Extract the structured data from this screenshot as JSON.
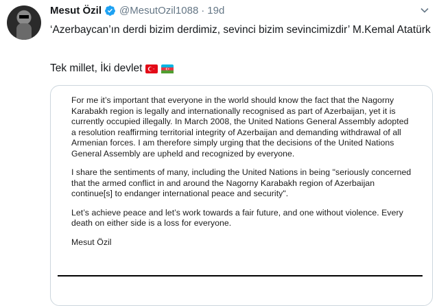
{
  "tweet": {
    "author_name": "Mesut Özil",
    "handle": "@MesutOzil1088",
    "separator": "·",
    "time": "19d",
    "text_line1": "‘Azerbaycan’ın derdi bizim derdimiz, sevinci bizim sevincimizdir’ M.Kemal Atatürk",
    "text_line2": "Tek millet, İki devlet",
    "flags": [
      "turkey-flag",
      "azerbaijan-flag"
    ]
  },
  "statement": {
    "paragraphs": [
      "For me it’s important that everyone in the world should know the fact that the Nagorny Karabakh region is legally and internationally recognised as part of Azerbaijan, yet it is currently occupied illegally. In March 2008, the United Nations General Assembly adopted a resolution reaffirming territorial integrity of Azerbaijan and demanding withdrawal of all Armenian forces. I am therefore simply urging that the decisions of the United Nations General Assembly are upheld and recognized by everyone.",
      "I share the sentiments of many, including the United Nations in being \"seriously concerned that the armed conflict in and around the Nagorny Karabakh region of Azerbaijan continue[s] to endanger international peace and security\".",
      "Let’s achieve peace and let’s work towards a fair future, and one without violence. Every death on either side is a loss for everyone."
    ],
    "signature": "Mesut Özil"
  },
  "colors": {
    "verified_badge": "#1da1f2",
    "secondary_text": "#657786",
    "card_border": "#ccd6dd"
  },
  "icons": [
    "verified-badge-icon",
    "chevron-down-icon"
  ]
}
